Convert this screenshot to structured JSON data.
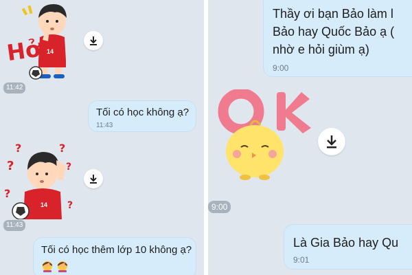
{
  "left_panel": {
    "sticker_1_text": "Hở",
    "sticker_1_time": "11:42",
    "sticker_1_jersey": "14",
    "bubble_1": {
      "text": "Tối có học không ạ?",
      "time": "11:43"
    },
    "sticker_2_time": "11:43",
    "sticker_2_jersey": "14",
    "bubble_2": {
      "text": "Tối có học thêm lớp 10 không ạ?",
      "emojis": [
        "🤦‍♀️",
        "🤦‍♀️"
      ]
    }
  },
  "right_panel": {
    "bubble_3": {
      "lines": [
        "Thầy ơi bạn Bảo làm l",
        "Bảo hay Quốc Bảo ạ (",
        "nhờ e hỏi giùm ạ)"
      ],
      "time": "9:00"
    },
    "sticker_ok_text": "OK",
    "sticker_ok_time": "9:00",
    "bubble_4": {
      "text": "Là Gia Bảo hay Qu",
      "time": "9:01"
    }
  },
  "icons": {
    "download": "download-icon",
    "question": "question-mark-icon",
    "exclaim": "exclamation-icon",
    "facepalm": "facepalm-emoji"
  },
  "colors": {
    "chat_background": "#dfe6ee",
    "bubble": "#d7ecfb",
    "time_chip": "#a7b2bd",
    "jersey_red": "#d8232a",
    "ok_pink": "#f07a8e",
    "chick_yellow": "#ffe36b"
  }
}
